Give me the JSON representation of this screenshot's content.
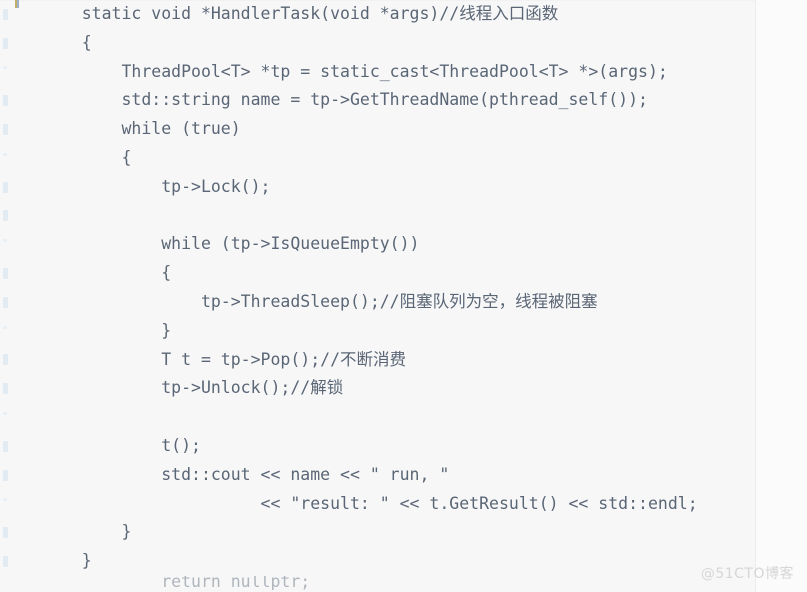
{
  "page": {
    "title": "C++ ThreadPool HandlerTask code snippet",
    "background_color": "#f7f7f8",
    "code_text_color": "#5a6675",
    "watermark_color": "#d6d6d6",
    "divider_color": "#ececec",
    "gutter_mark_color": "#dbe6f0"
  },
  "watermark": {
    "text": "@51CTO博客"
  },
  "code": {
    "language": "cpp",
    "lines": [
      "    static void *HandlerTask(void *args)//线程入口函数",
      "    {",
      "        ThreadPool<T> *tp = static_cast<ThreadPool<T> *>(args);",
      "        std::string name = tp->GetThreadName(pthread_self());",
      "        while (true)",
      "        {",
      "            tp->Lock();",
      "",
      "            while (tp->IsQueueEmpty())",
      "            {",
      "                tp->ThreadSleep();//阻塞队列为空，线程被阻塞",
      "            }",
      "            T t = tp->Pop();//不断消费",
      "            tp->Unlock();//解锁",
      "",
      "            t();",
      "            std::cout << name << \" run, \"",
      "                      << \"result: \" << t.GetResult() << std::endl;",
      "        }",
      "    }"
    ],
    "partial_last_line": "            return nullptr;"
  },
  "gutter": {
    "mark_rows": [
      1,
      2,
      3,
      4,
      5,
      6,
      7,
      8,
      9,
      10,
      11,
      12,
      13,
      14,
      15,
      16,
      17,
      18,
      19,
      20
    ]
  }
}
